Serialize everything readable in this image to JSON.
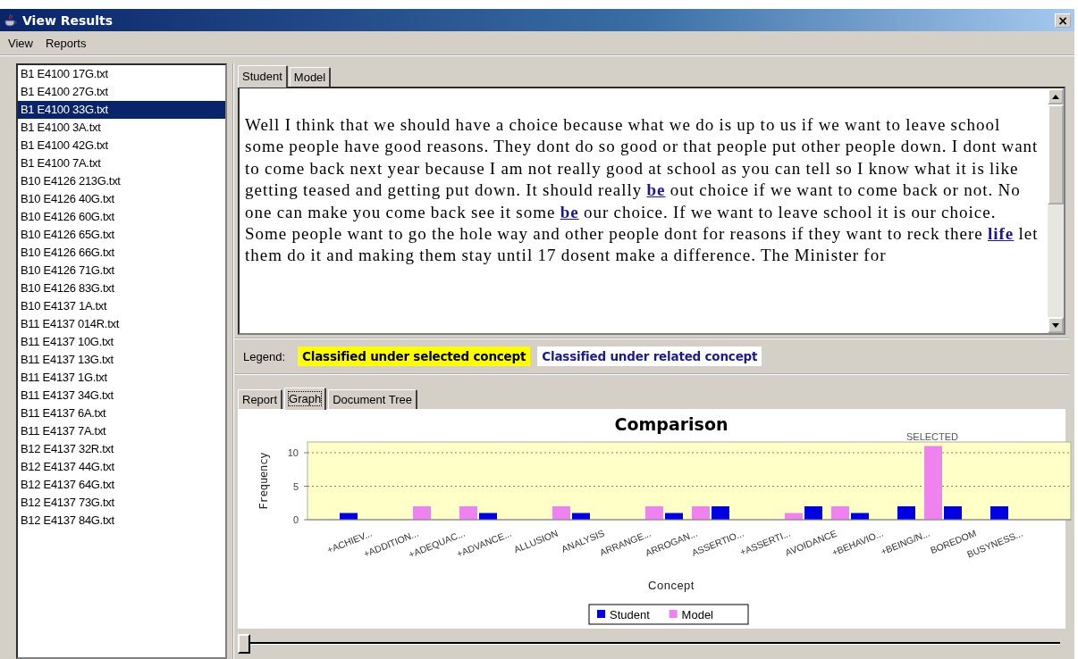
{
  "window": {
    "title": "View Results",
    "close": "×"
  },
  "menu": [
    "View",
    "Reports"
  ],
  "files": [
    {
      "label": "B1 E4100 17G.txt",
      "selected": false
    },
    {
      "label": "B1 E4100 27G.txt",
      "selected": false
    },
    {
      "label": "B1 E4100 33G.txt",
      "selected": true
    },
    {
      "label": "B1 E4100 3A.txt",
      "selected": false
    },
    {
      "label": "B1 E4100 42G.txt",
      "selected": false
    },
    {
      "label": "B1 E4100 7A.txt",
      "selected": false
    },
    {
      "label": "B10 E4126 213G.txt",
      "selected": false
    },
    {
      "label": "B10 E4126 40G.txt",
      "selected": false
    },
    {
      "label": "B10 E4126 60G.txt",
      "selected": false
    },
    {
      "label": "B10 E4126 65G.txt",
      "selected": false
    },
    {
      "label": "B10 E4126 66G.txt",
      "selected": false
    },
    {
      "label": "B10 E4126 71G.txt",
      "selected": false
    },
    {
      "label": "B10 E4126 83G.txt",
      "selected": false
    },
    {
      "label": "B10 E4137 1A.txt",
      "selected": false
    },
    {
      "label": "B11 E4137 014R.txt",
      "selected": false
    },
    {
      "label": "B11 E4137 10G.txt",
      "selected": false
    },
    {
      "label": "B11 E4137 13G.txt",
      "selected": false
    },
    {
      "label": "B11 E4137 1G.txt",
      "selected": false
    },
    {
      "label": "B11 E4137 34G.txt",
      "selected": false
    },
    {
      "label": "B11 E4137 6A.txt",
      "selected": false
    },
    {
      "label": "B11 E4137 7A.txt",
      "selected": false
    },
    {
      "label": "B12 E4137 32R.txt",
      "selected": false
    },
    {
      "label": "B12 E4137 44G.txt",
      "selected": false
    },
    {
      "label": "B12 E4137 64G.txt",
      "selected": false
    },
    {
      "label": "B12 E4137 73G.txt",
      "selected": false
    },
    {
      "label": "B12 E4137 84G.txt",
      "selected": false
    }
  ],
  "document_tabs": [
    {
      "label": "Student",
      "selected": true
    },
    {
      "label": "Model",
      "selected": false
    }
  ],
  "document_text": "Well I think that we should have a choice because what we do is up to us if we want to leave school some people have good reasons.  They dont do so good or that people put other people down. I dont want to come back next year because I am not really good at school as you can tell so I know what it is like getting teased and getting put down.  It should really **be** out choice if we want to come back or not. No one can make you come back see it some **be** our choice.  If we want to leave school it is our choice.  Some people want to go the hole way and other people dont for reasons if they want to reck there **life** let them do it and making them stay until 17 dosent make a difference.  The Minister for",
  "legend": {
    "label": "Legend:",
    "items": [
      {
        "text": "Classified under selected concept",
        "color": "#ffff00"
      },
      {
        "text": "Classified under related concept",
        "color": "#ffffff"
      }
    ]
  },
  "result_tabs": [
    {
      "label": "Report",
      "selected": false
    },
    {
      "label": "Graph",
      "selected": true
    },
    {
      "label": "Document Tree",
      "selected": false
    }
  ],
  "graph": {
    "chart_data": {
      "type": "bar",
      "title": "Comparison",
      "xlabel": "Concept",
      "ylabel": "Frequency",
      "categories": [
        "+ACHIEV...",
        "+ADDITION...",
        "+ADEQUAC...",
        "+ADVANCE...",
        "ALLUSION",
        "ANALYSIS",
        "ARRANGE...",
        "ARROGAN...",
        "ASSERTIO...",
        "+ASSERTI...",
        "AVOIDANCE",
        "+BEHAVIO...",
        "+BEING/N...",
        "BOREDOM",
        "BUSYNESS..."
      ],
      "series": [
        {
          "name": "Student",
          "color": "#0000e0",
          "values": [
            1,
            0,
            0,
            1,
            0,
            1,
            0,
            1,
            2,
            0,
            2,
            1,
            2,
            2,
            2
          ]
        },
        {
          "name": "Model",
          "color": "#ee82ee",
          "values": [
            0,
            2,
            2,
            0,
            2,
            0,
            2,
            2,
            0,
            1,
            2,
            0,
            11,
            0,
            0
          ]
        }
      ],
      "ylim": [
        0,
        11.6
      ],
      "yticks": [
        0,
        5,
        10
      ],
      "legend": "bottom",
      "annotations": [
        "SELECTED"
      ]
    }
  },
  "slider": {
    "level": 0
  }
}
